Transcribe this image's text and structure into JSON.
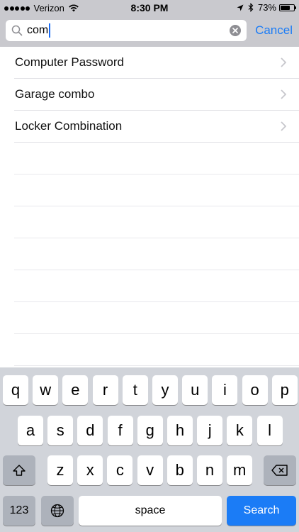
{
  "status_bar": {
    "carrier": "Verizon",
    "time": "8:30 PM",
    "battery_text": "73%",
    "battery_level": 0.73,
    "icons": [
      "signal-dots-icon",
      "wifi-icon",
      "location-arrow-icon",
      "bluetooth-icon",
      "battery-icon"
    ]
  },
  "search": {
    "value": "com",
    "cancel_label": "Cancel"
  },
  "results": [
    {
      "label": "Computer Password"
    },
    {
      "label": "Garage combo"
    },
    {
      "label": "Locker Combination"
    }
  ],
  "keyboard": {
    "row1": [
      "q",
      "w",
      "e",
      "r",
      "t",
      "y",
      "u",
      "i",
      "o",
      "p"
    ],
    "row2": [
      "a",
      "s",
      "d",
      "f",
      "g",
      "h",
      "j",
      "k",
      "l"
    ],
    "row3": [
      "z",
      "x",
      "c",
      "v",
      "b",
      "n",
      "m"
    ],
    "numbers_label": "123",
    "space_label": "space",
    "search_label": "Search"
  },
  "colors": {
    "accent": "#1b7cf6",
    "header_bg": "#c9c9ce",
    "keyboard_bg": "#d1d4da"
  }
}
